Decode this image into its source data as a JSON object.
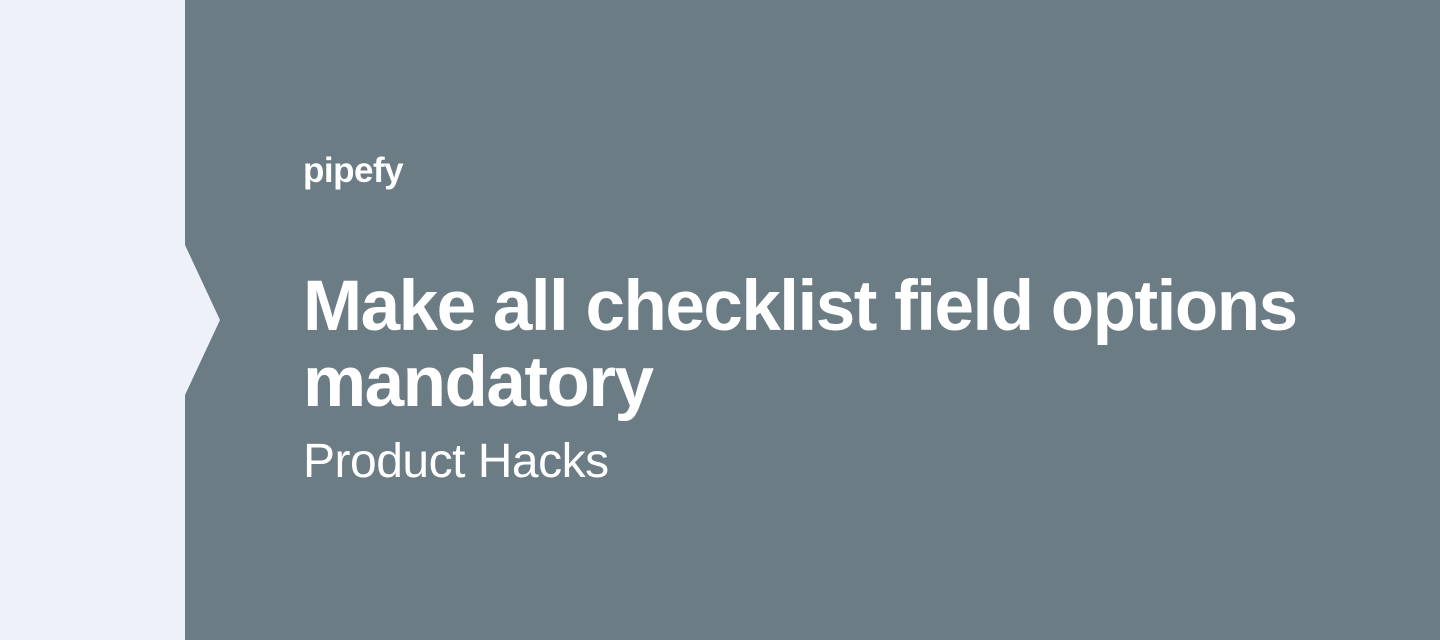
{
  "brand": "pipefy",
  "title": "Make all checklist field options mandatory",
  "subtitle": "Product Hacks",
  "colors": {
    "sidebar": "#eef1f9",
    "main": "#6b7c85",
    "text": "#ffffff"
  }
}
